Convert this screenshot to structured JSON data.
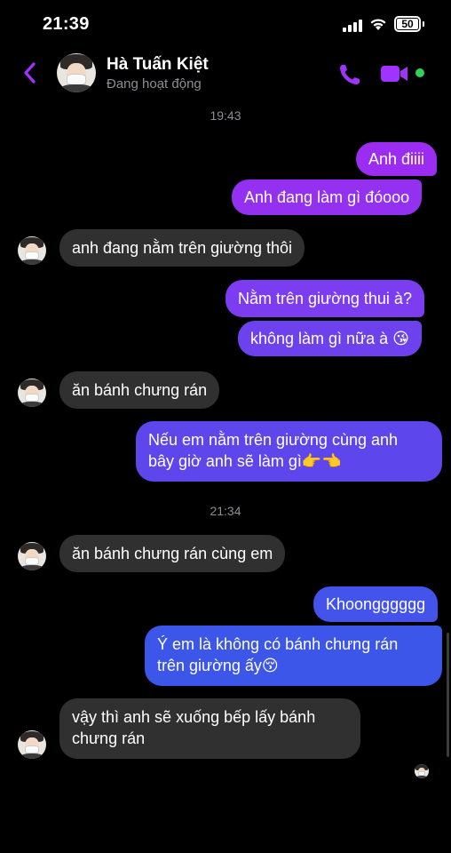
{
  "status_bar": {
    "time": "21:39",
    "battery": "50"
  },
  "header": {
    "contact_name": "Hà Tuấn Kiệt",
    "presence": "Đang hoạt động"
  },
  "messages": {
    "ts1": "19:43",
    "m1": "Anh điiii",
    "m2": "Anh đang làm gì đóooo",
    "m3": "anh đang nằm trên giường thôi",
    "m4": "Nằm trên giường thui à?",
    "m5": "không làm gì nữa à 😘",
    "m6": "ăn bánh chưng rán",
    "m7_line1": "Nếu em nằm trên giường cùng anh",
    "m7_line2": "bây giờ anh sẽ làm gì👉👈",
    "ts2": "21:34",
    "m8": "ăn bánh chưng rán cùng em",
    "m9": "Khoongggggg",
    "m10_line1": "Ý em là không có bánh chưng rán",
    "m10_line2": "trên giường ấy😚",
    "m11_line1": "vậy thì anh sẽ xuống bếp lấy bánh",
    "m11_line2": "chưng rán"
  },
  "colors": {
    "accent": "#a033ff",
    "outgoing_top": "#9a2cf0",
    "outgoing_bottom": "#3a55e6",
    "incoming": "#303030"
  },
  "icons": [
    "back-chevron-icon",
    "phone-icon",
    "video-camera-icon",
    "signal-icon",
    "wifi-icon",
    "battery-icon"
  ]
}
